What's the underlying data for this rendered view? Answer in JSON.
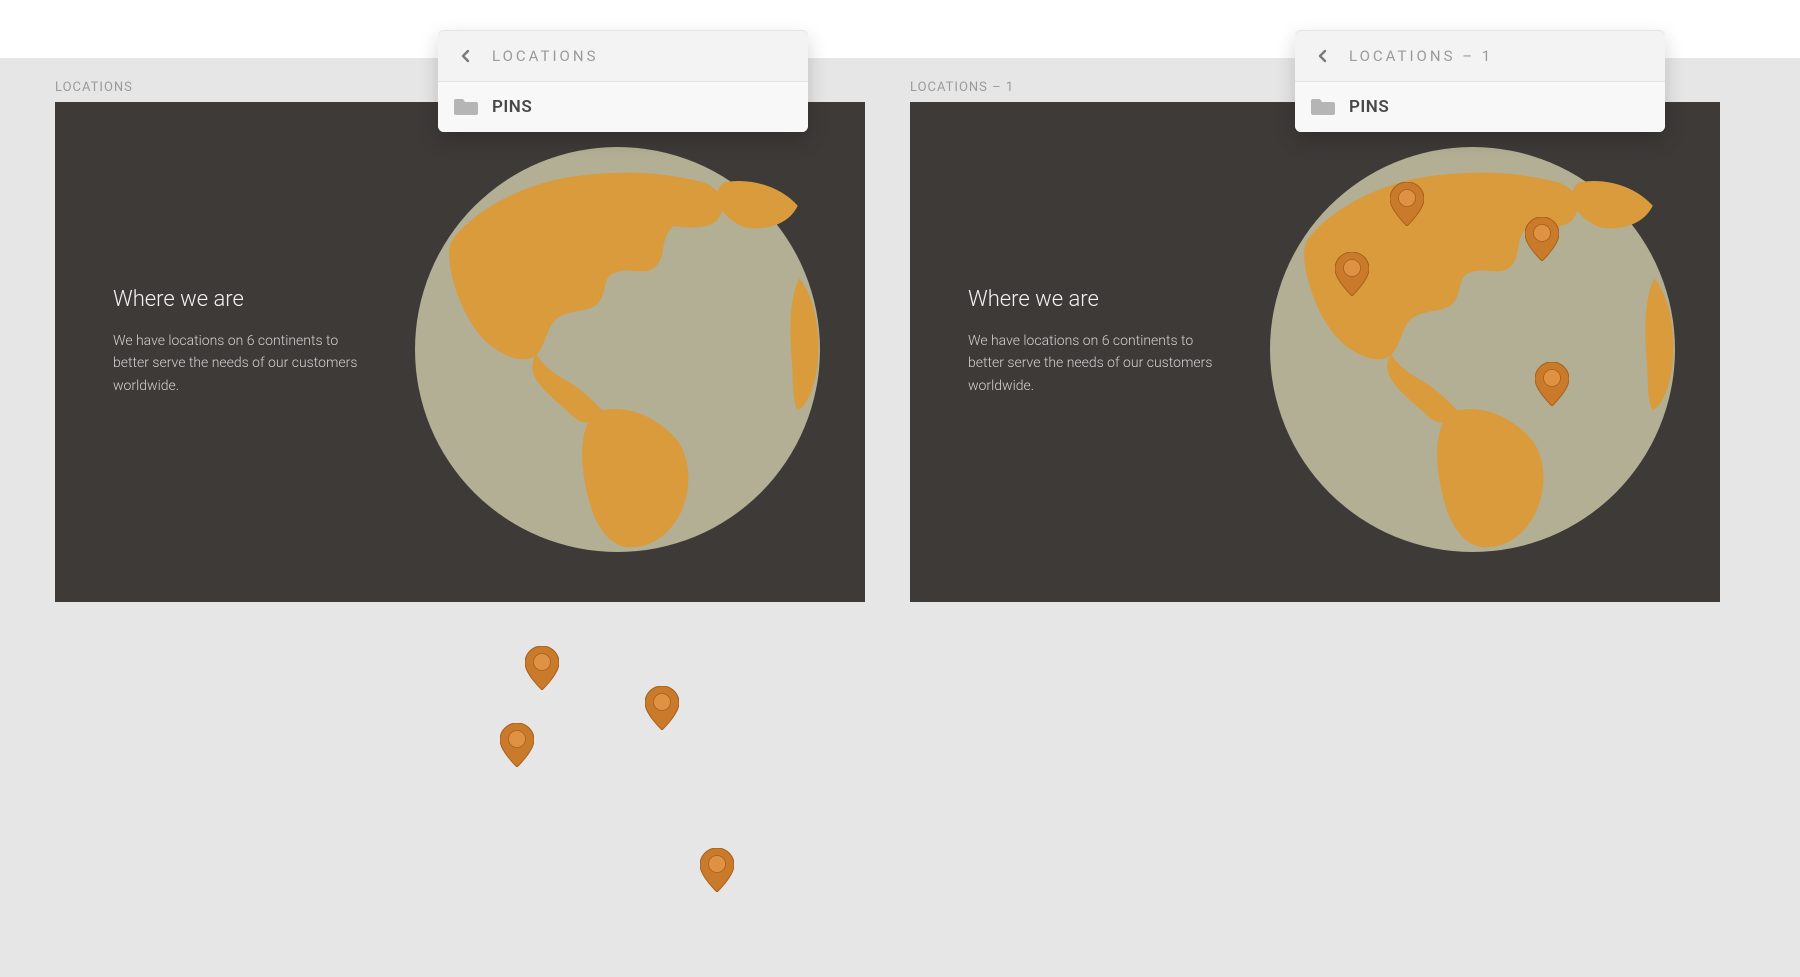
{
  "artboards": [
    {
      "label": "LOCATIONS",
      "title": "Where we are",
      "desc": "We have locations on 6 continents to better serve the needs of our customers worldwide."
    },
    {
      "label": "LOCATIONS – 1",
      "title": "Where we are",
      "desc": "We have locations on 6 continents to better serve the needs of our customers worldwide."
    }
  ],
  "popovers": [
    {
      "title": "LOCATIONS",
      "row": "PINS"
    },
    {
      "title": "LOCATIONS – 1",
      "row": "PINS"
    }
  ],
  "colors": {
    "globe_bg": "#b3af95",
    "continents": "#d99b3b",
    "pin_fill": "#c97a2a",
    "pin_stroke": "#a85f1c",
    "pin_inner": "#e09244"
  }
}
